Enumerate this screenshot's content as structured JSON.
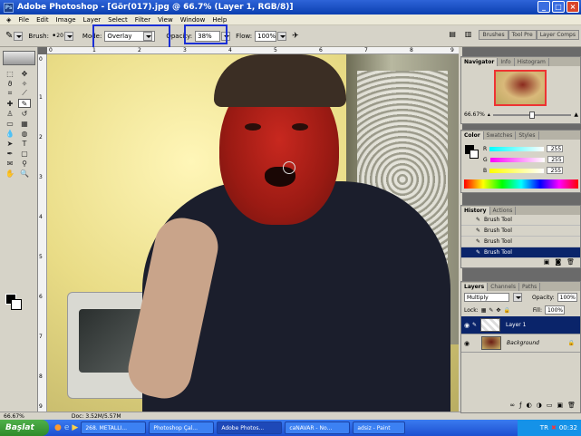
{
  "window": {
    "title": "Adobe Photoshop - [Gör(017).jpg @ 66.7% (Layer 1, RGB/8)]",
    "min": "_",
    "max": "□",
    "close": "×"
  },
  "menu": [
    "File",
    "Edit",
    "Image",
    "Layer",
    "Select",
    "Filter",
    "View",
    "Window",
    "Help"
  ],
  "options": {
    "brush_label": "Brush:",
    "brush_size": "20",
    "mode_label": "Mode:",
    "mode_value": "Overlay",
    "opacity_label": "Opacity:",
    "opacity_value": "38%",
    "flow_label": "Flow:",
    "flow_value": "100%"
  },
  "palette_well": [
    "Brushes",
    "Tool Pre",
    "Layer Comps"
  ],
  "rulers": {
    "top": [
      "0",
      "1",
      "2",
      "3",
      "4",
      "5",
      "6",
      "7",
      "8",
      "9"
    ],
    "left": [
      "0",
      "1",
      "2",
      "3",
      "4",
      "5",
      "6",
      "7",
      "8",
      "9"
    ]
  },
  "status": {
    "zoom": "66.67%",
    "doc": "Doc: 3.52M/5.57M"
  },
  "navigator": {
    "tabs": [
      "Navigator",
      "Info",
      "Histogram"
    ],
    "zoom": "66.67%"
  },
  "color": {
    "tabs": [
      "Color",
      "Swatches",
      "Styles"
    ],
    "channels": [
      {
        "label": "R",
        "value": "255",
        "color": "#00e5e5"
      },
      {
        "label": "G",
        "value": "255",
        "color": "#e040e0"
      },
      {
        "label": "B",
        "value": "255",
        "color": "#e5e500"
      }
    ]
  },
  "history": {
    "tabs": [
      "History",
      "Actions"
    ],
    "items": [
      "Brush Tool",
      "Brush Tool",
      "Brush Tool",
      "Brush Tool"
    ]
  },
  "layers": {
    "tabs": [
      "Layers",
      "Channels",
      "Paths"
    ],
    "blend": "Multiply",
    "opacity_label": "Opacity:",
    "opacity": "100%",
    "lock_label": "Lock:",
    "fill_label": "Fill:",
    "fill": "100%",
    "items": [
      {
        "name": "Layer 1"
      },
      {
        "name": "Background"
      }
    ]
  },
  "taskbar": {
    "start": "Başlat",
    "tasks": [
      "268. METALLI...",
      "Photoshop Çal...",
      "Adobe Photos...",
      "caNAVAR - No...",
      "adsiz - Paint"
    ],
    "lang": "TR",
    "time": "00:32"
  },
  "accent": "#0a246a",
  "highlight_color": "#1a2fd6"
}
